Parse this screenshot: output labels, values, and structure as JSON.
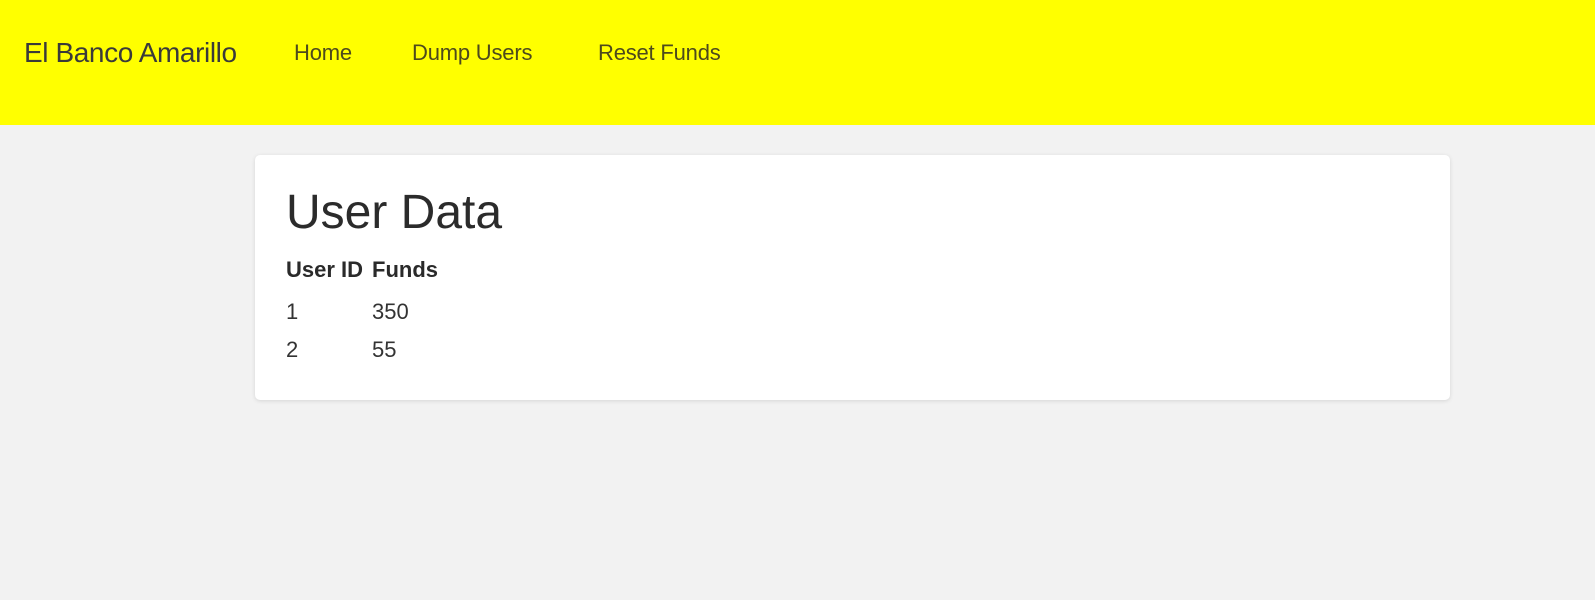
{
  "navbar": {
    "brand": "El Banco Amarillo",
    "links": [
      {
        "label": "Home"
      },
      {
        "label": "Dump Users"
      },
      {
        "label": "Reset Funds"
      }
    ],
    "background_color": "#ffff00"
  },
  "main": {
    "title": "User Data",
    "table": {
      "headers": [
        "User ID",
        "Funds"
      ],
      "rows": [
        [
          "1",
          "350"
        ],
        [
          "2",
          "55"
        ]
      ]
    }
  }
}
